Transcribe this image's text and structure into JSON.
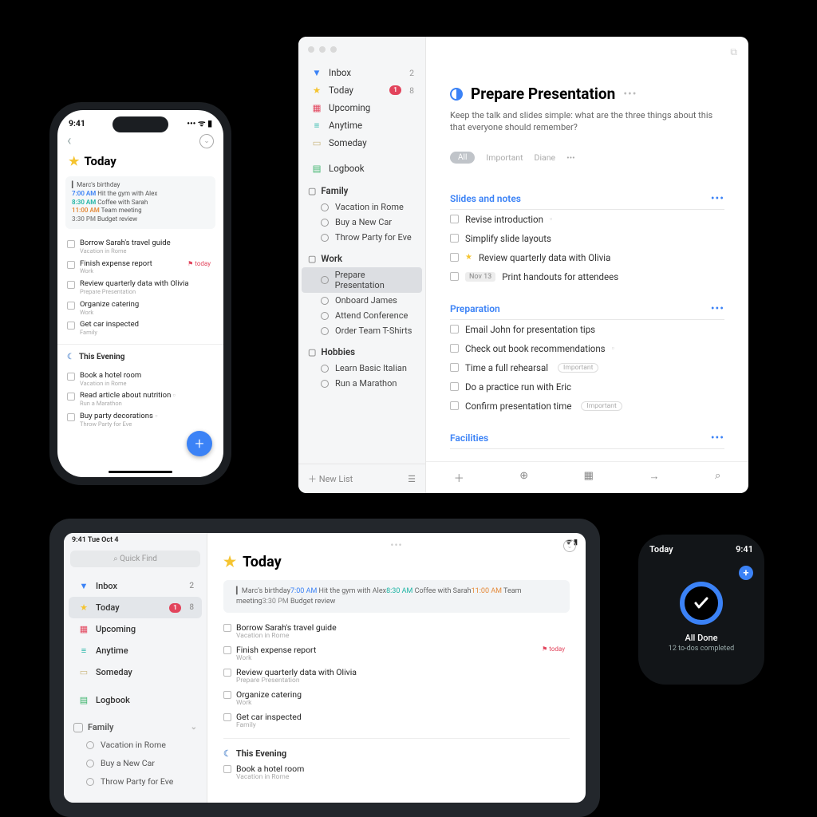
{
  "iphone": {
    "time": "9:41",
    "signal_glyph": "􀙇 􀛨",
    "title": "Today",
    "calendar": {
      "birthday": "Marc's birthday",
      "events": [
        {
          "time": "7:00 AM",
          "label": "Hit the gym with Alex",
          "color": "c-blue"
        },
        {
          "time": "8:30 AM",
          "label": "Coffee with Sarah",
          "color": "c-teal"
        },
        {
          "time": "11:00 AM",
          "label": "Team meeting",
          "color": "c-orange"
        },
        {
          "time": "3:30 PM",
          "label": "Budget review",
          "color": "c-gray"
        }
      ]
    },
    "tasks": [
      {
        "title": "Borrow Sarah's travel guide",
        "sub": "Vacation in Rome"
      },
      {
        "title": "Finish expense report",
        "sub": "Work",
        "flag": "today"
      },
      {
        "title": "Review quarterly data with Olivia",
        "sub": "Prepare Presentation"
      },
      {
        "title": "Organize catering",
        "sub": "Work"
      },
      {
        "title": "Get car inspected",
        "sub": "Family"
      }
    ],
    "evening_label": "This Evening",
    "evening": [
      {
        "title": "Book a hotel room",
        "sub": "Vacation in Rome"
      },
      {
        "title": "Read article about nutrition",
        "sub": "Run a Marathon",
        "attach": true
      },
      {
        "title": "Buy party decorations",
        "sub": "Throw Party for Eve",
        "attach": true
      }
    ]
  },
  "mac": {
    "sidebar": {
      "lists": [
        {
          "icon": "📥",
          "label": "Inbox",
          "count": "2",
          "color": "#3b82f6"
        },
        {
          "icon": "★",
          "label": "Today",
          "badge": "1",
          "count": "8",
          "color": "#f5c430"
        },
        {
          "icon": "📅",
          "label": "Upcoming",
          "color": "#e2445c"
        },
        {
          "icon": "📚",
          "label": "Anytime",
          "color": "#1db4a4"
        },
        {
          "icon": "📦",
          "label": "Someday",
          "color": "#c8b47a"
        }
      ],
      "logbook": {
        "icon": "📗",
        "label": "Logbook"
      },
      "areas": [
        {
          "name": "Family",
          "projects": [
            "Vacation in Rome",
            "Buy a New Car",
            "Throw Party for Eve"
          ]
        },
        {
          "name": "Work",
          "projects": [
            "Prepare Presentation",
            "Onboard James",
            "Attend Conference",
            "Order Team T-Shirts"
          ],
          "selected": "Prepare Presentation"
        },
        {
          "name": "Hobbies",
          "projects": [
            "Learn Basic Italian",
            "Run a Marathon"
          ]
        }
      ],
      "footer": "New List"
    },
    "project": {
      "title": "Prepare Presentation",
      "desc": "Keep the talk and slides simple: what are the three things about this that everyone should remember?",
      "tags": {
        "all": "All",
        "items": [
          "Important",
          "Diane"
        ]
      },
      "sections": [
        {
          "name": "Slides and notes",
          "tasks": [
            {
              "t": "Revise introduction",
              "attach": true
            },
            {
              "t": "Simplify slide layouts"
            },
            {
              "t": "Review quarterly data with Olivia",
              "star": true
            },
            {
              "t": "Print handouts for attendees",
              "date": "Nov 13"
            }
          ]
        },
        {
          "name": "Preparation",
          "tasks": [
            {
              "t": "Email John for presentation tips"
            },
            {
              "t": "Check out book recommendations",
              "attach": true
            },
            {
              "t": "Time a full rehearsal",
              "tag": "Important"
            },
            {
              "t": "Do a practice run with Eric"
            },
            {
              "t": "Confirm presentation time",
              "tag": "Important"
            }
          ]
        },
        {
          "name": "Facilities",
          "tasks": []
        }
      ]
    }
  },
  "ipad": {
    "status_left": "9:41  Tue Oct 4",
    "quickfind": "Quick Find",
    "sidebar": [
      {
        "icon": "📥",
        "label": "Inbox",
        "count": "2"
      },
      {
        "icon": "★",
        "label": "Today",
        "badge": "1",
        "count": "8",
        "sel": true,
        "iconColor": "#f5c430"
      },
      {
        "icon": "📅",
        "label": "Upcoming",
        "iconColor": "#e2445c"
      },
      {
        "icon": "📚",
        "label": "Anytime",
        "iconColor": "#1db4a4"
      },
      {
        "icon": "📦",
        "label": "Someday",
        "iconColor": "#c8b47a"
      },
      {
        "icon": "📗",
        "label": "Logbook",
        "iconColor": "#39b36a",
        "gap": true
      }
    ],
    "area": {
      "name": "Family",
      "projects": [
        "Vacation in Rome",
        "Buy a New Car",
        "Throw Party for Eve"
      ]
    },
    "title": "Today",
    "calendar": {
      "birthday": "Marc's birthday",
      "events": [
        {
          "time": "7:00 AM",
          "label": "Hit the gym with Alex",
          "color": "c-blue"
        },
        {
          "time": "8:30 AM",
          "label": "Coffee with Sarah",
          "color": "c-teal"
        },
        {
          "time": "11:00 AM",
          "label": "Team meeting",
          "color": "c-orange"
        },
        {
          "time": "3:30 PM",
          "label": "Budget review",
          "color": "c-gray"
        }
      ]
    },
    "tasks": [
      {
        "title": "Borrow Sarah's travel guide",
        "sub": "Vacation in Rome"
      },
      {
        "title": "Finish expense report",
        "sub": "Work",
        "flag": "today"
      },
      {
        "title": "Review quarterly data with Olivia",
        "sub": "Prepare Presentation"
      },
      {
        "title": "Organize catering",
        "sub": "Work"
      },
      {
        "title": "Get car inspected",
        "sub": "Family"
      }
    ],
    "evening_label": "This Evening",
    "evening": [
      {
        "title": "Book a hotel room",
        "sub": "Vacation in Rome"
      }
    ]
  },
  "watch": {
    "title": "Today",
    "time": "9:41",
    "msg": "All Done",
    "sub": "12 to-dos completed"
  }
}
